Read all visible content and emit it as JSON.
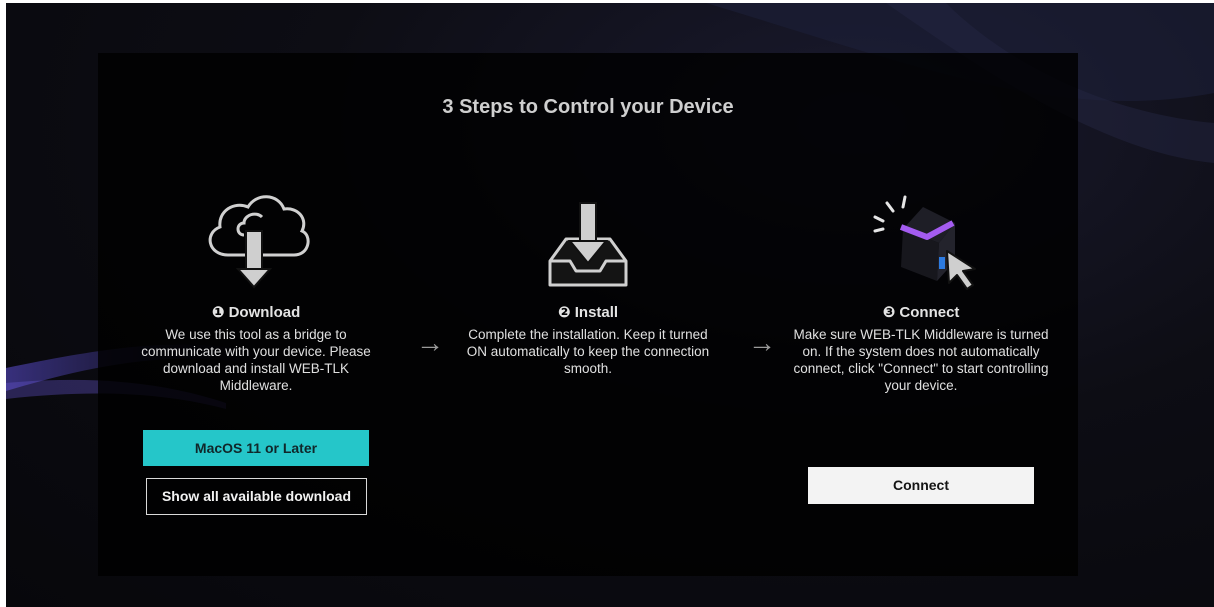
{
  "title": "3 Steps to Control your Device",
  "steps": [
    {
      "icon": "cloud-download-icon",
      "title": "❶ Download",
      "description": "We use this tool as a bridge to communicate with your device. Please download and install WEB-TLK Middleware."
    },
    {
      "icon": "install-tray-icon",
      "title": "❷ Install",
      "description": "Complete the installation. Keep it turned ON automatically to keep the connection smooth."
    },
    {
      "icon": "connect-cube-icon",
      "title": "❸ Connect",
      "description": "Make sure WEB-TLK Middleware is turned on. If the system does not automatically connect, click \"Connect\" to start controlling your device."
    }
  ],
  "arrows": [
    "→",
    "→"
  ],
  "buttons": {
    "macos": "MacOS 11 or Later",
    "show_all": "Show all available download",
    "connect": "Connect"
  },
  "colors": {
    "accent": "#25c6c9",
    "cube_accent": "#a45cf0",
    "cube_edge": "#2d7be0"
  }
}
